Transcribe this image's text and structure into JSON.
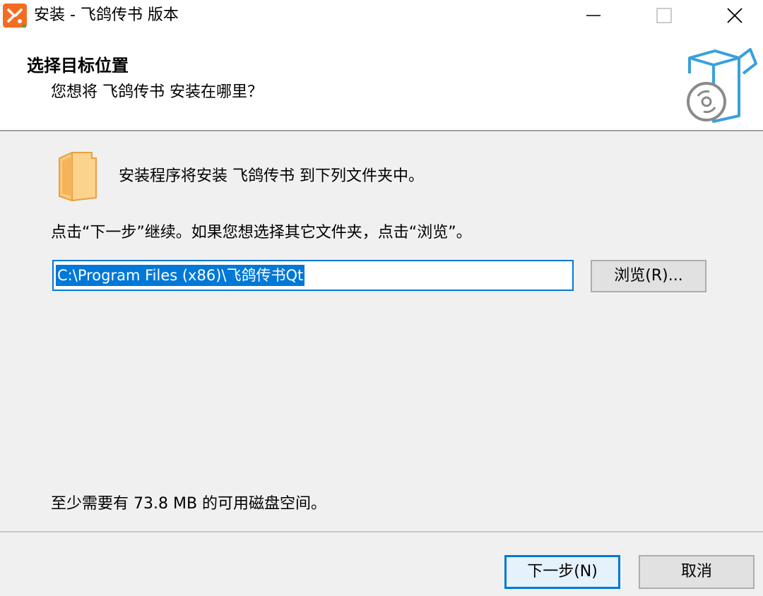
{
  "window": {
    "title": "安装 - 飞鸽传书 版本",
    "icon": "app-logo-icon",
    "controls": [
      "minimize-icon",
      "maximize-icon",
      "close-icon"
    ]
  },
  "header": {
    "title": "选择目标位置",
    "subtitle": "您想将 飞鸽传书 安装在哪里？",
    "graphic_icon": "install-box-disc-icon"
  },
  "body": {
    "folder_icon": "folder-icon",
    "intro": "安装程序将安装 飞鸽传书 到下列文件夹中。",
    "instruction": "点击“下一步”继续。如果您想选择其它文件夹，点击“浏览”。",
    "path_value": "C:\\Program Files (x86)\\飞鸽传书Qt",
    "browse_label": "浏览(R)...",
    "space_required": "至少需要有 73.8 MB 的可用磁盘空间。"
  },
  "footer": {
    "next_label": "下一步(N)",
    "cancel_label": "取消"
  },
  "colors": {
    "accent": "#0078d7",
    "app_icon": "#f26d21",
    "folder": "#f8c77a",
    "background": "#f0f0f0"
  }
}
